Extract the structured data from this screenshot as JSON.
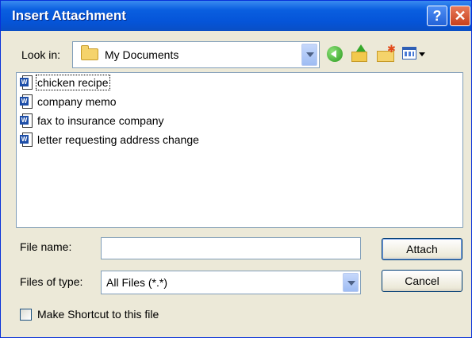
{
  "window": {
    "title": "Insert Attachment",
    "help_symbol": "?",
    "close_symbol": "✕"
  },
  "look_in": {
    "label": "Look in:",
    "value": "My Documents"
  },
  "toolbar": {
    "icons": [
      "back-icon",
      "up-folder-icon",
      "new-folder-icon",
      "views-menu-icon"
    ]
  },
  "files": [
    {
      "name": "chicken recipe",
      "icon_letter": "W"
    },
    {
      "name": "company memo",
      "icon_letter": "W"
    },
    {
      "name": "fax to insurance company",
      "icon_letter": "W"
    },
    {
      "name": "letter requesting address change",
      "icon_letter": "W"
    }
  ],
  "file_name": {
    "label": "File name:",
    "value": ""
  },
  "file_type": {
    "label": "Files of type:",
    "value": "All Files (*.*)"
  },
  "buttons": {
    "attach": "Attach",
    "cancel": "Cancel"
  },
  "shortcut": {
    "label": "Make Shortcut to this file",
    "checked": false
  },
  "colors": {
    "titlebar": "#0554d8",
    "dialog_bg": "#ece9d8",
    "border": "#7f9db9"
  }
}
